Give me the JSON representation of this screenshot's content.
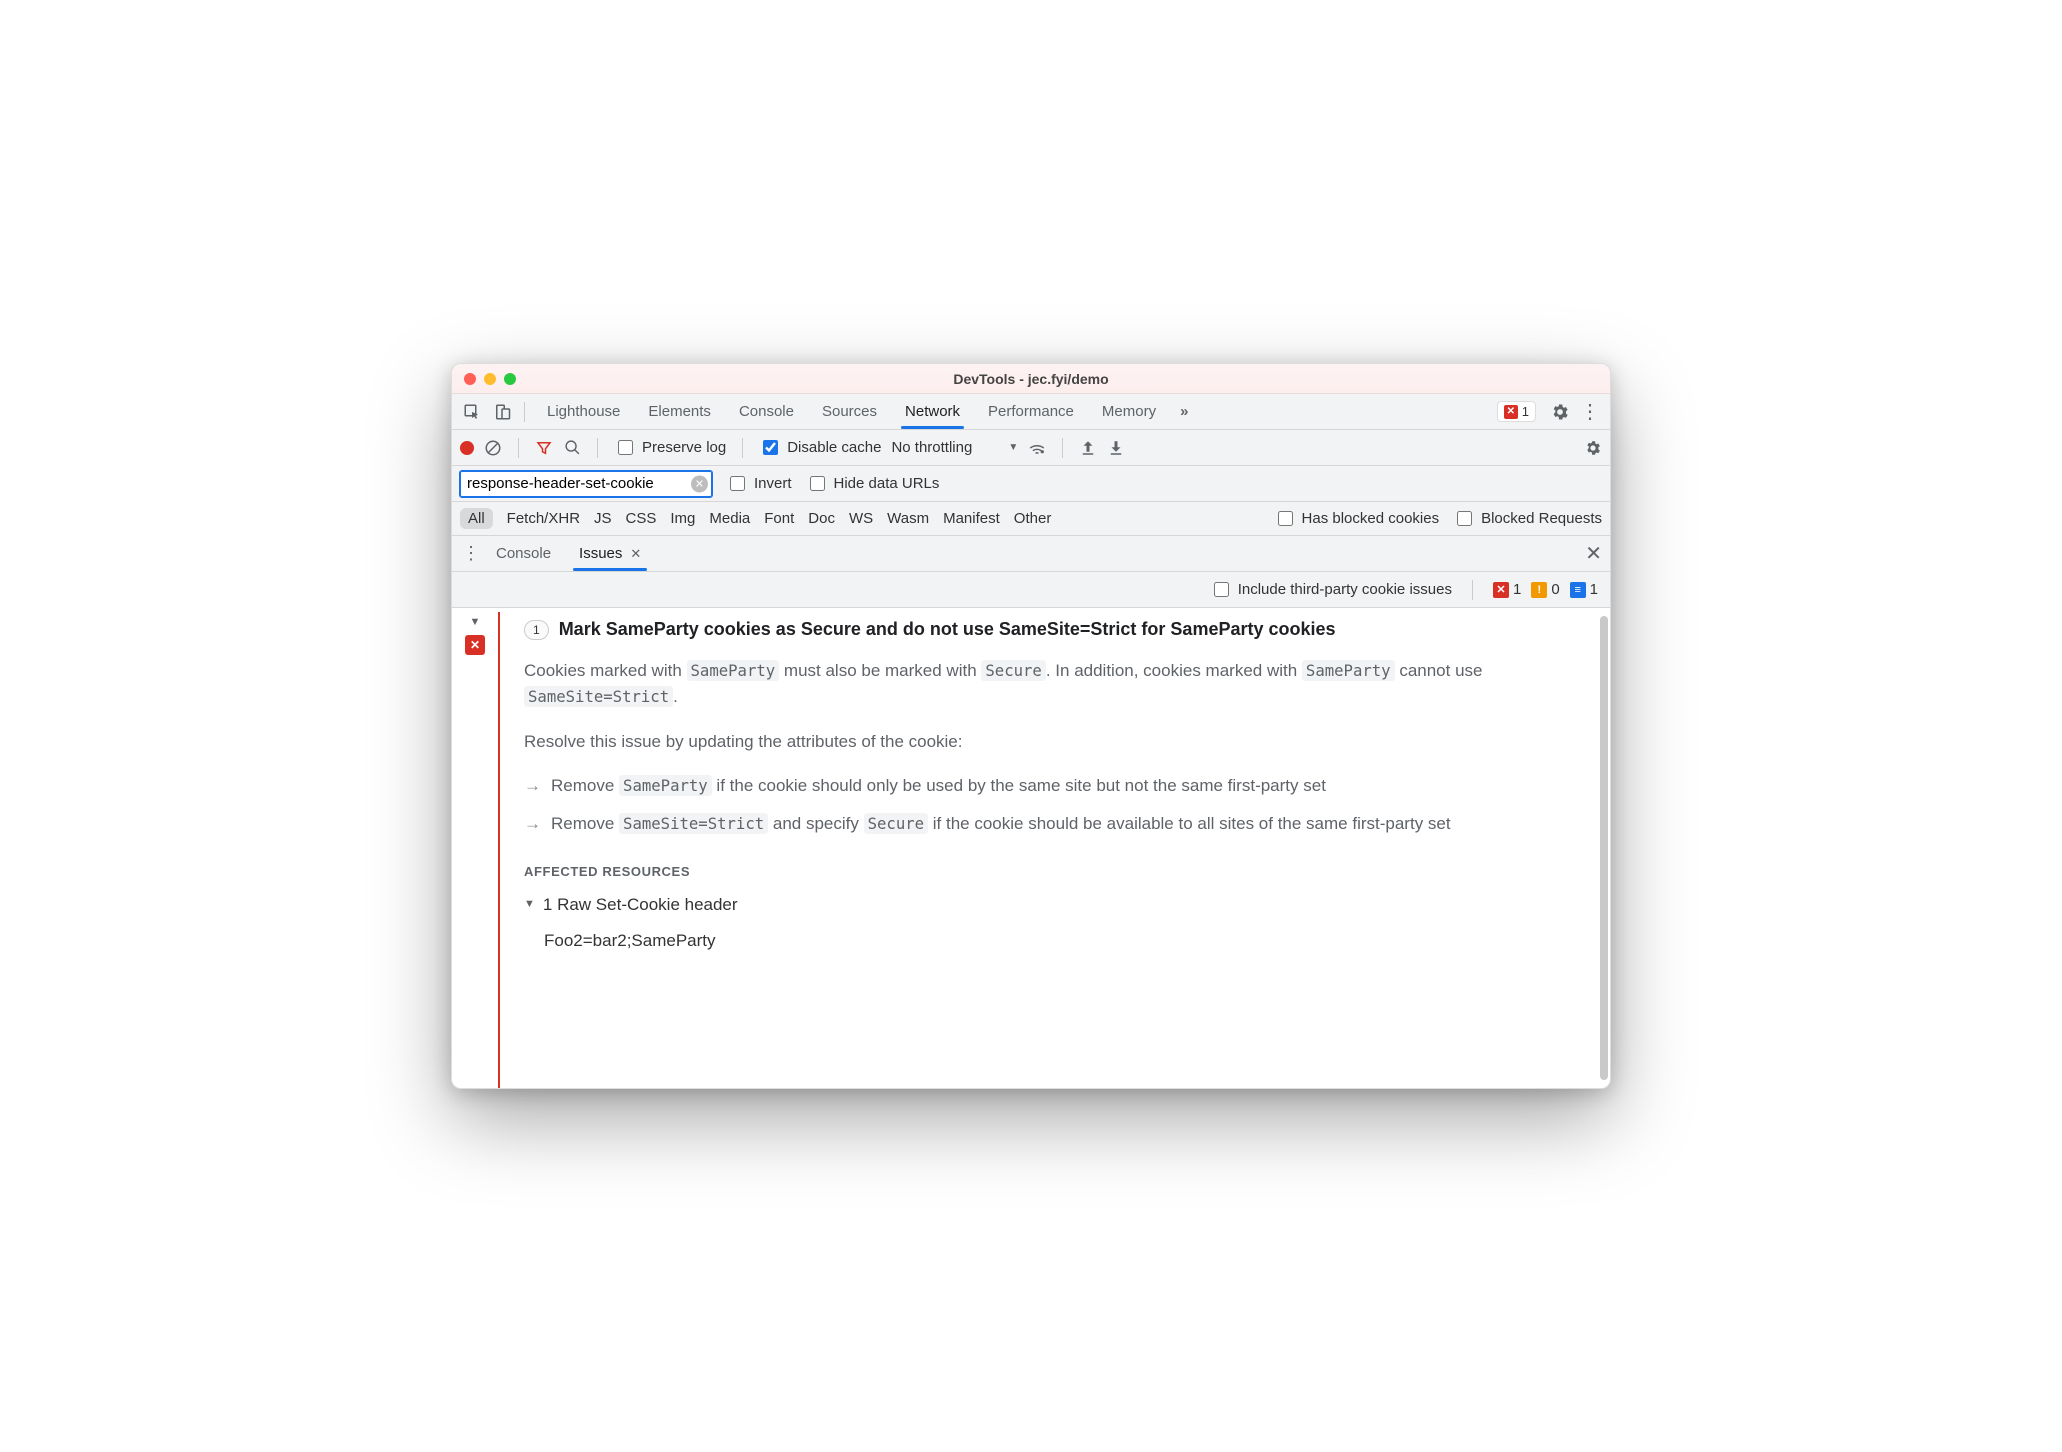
{
  "window": {
    "title": "DevTools - jec.fyi/demo"
  },
  "mainTabs": {
    "items": [
      "Lighthouse",
      "Elements",
      "Console",
      "Sources",
      "Network",
      "Performance",
      "Memory"
    ],
    "activeIndex": 4,
    "overflowGlyph": "»",
    "errorCount": "1"
  },
  "networkToolbar": {
    "preserveLog": {
      "label": "Preserve log",
      "checked": false
    },
    "disableCache": {
      "label": "Disable cache",
      "checked": true
    },
    "throttling": "No throttling"
  },
  "filterRow": {
    "filterValue": "response-header-set-cookie",
    "invert": {
      "label": "Invert",
      "checked": false
    },
    "hideDataUrls": {
      "label": "Hide data URLs",
      "checked": false
    }
  },
  "typeFilters": {
    "items": [
      "All",
      "Fetch/XHR",
      "JS",
      "CSS",
      "Img",
      "Media",
      "Font",
      "Doc",
      "WS",
      "Wasm",
      "Manifest",
      "Other"
    ],
    "activeIndex": 0,
    "hasBlockedCookies": {
      "label": "Has blocked cookies",
      "checked": false
    },
    "blockedRequests": {
      "label": "Blocked Requests",
      "checked": false
    }
  },
  "drawer": {
    "tabs": [
      "Console",
      "Issues"
    ],
    "activeIndex": 1
  },
  "issuesHeader": {
    "includeThirdParty": {
      "label": "Include third-party cookie issues",
      "checked": false
    },
    "counts": {
      "error": "1",
      "warning": "0",
      "info": "1"
    }
  },
  "issue": {
    "count": "1",
    "title": "Mark SameParty cookies as Secure and do not use SameSite=Strict for SameParty cookies",
    "desc": {
      "p1a": "Cookies marked with ",
      "p1b": " must also be marked with ",
      "p1c": ". In addition, cookies marked with ",
      "p1d": " cannot use ",
      "code1": "SameParty",
      "code2": "Secure",
      "code3": "SameParty",
      "code4": "SameSite=Strict",
      "resolve": "Resolve this issue by updating the attributes of the cookie:"
    },
    "bullets": {
      "b1a": "Remove ",
      "b1code": "SameParty",
      "b1b": " if the cookie should only be used by the same site but not the same first-party set",
      "b2a": "Remove ",
      "b2code1": "SameSite=Strict",
      "b2b": " and specify ",
      "b2code2": "Secure",
      "b2c": " if the cookie should be available to all sites of the same first-party set"
    },
    "affected": {
      "heading": "AFFECTED RESOURCES",
      "resourceLabel": "1 Raw Set-Cookie header",
      "cookie": "Foo2=bar2;SameParty"
    }
  }
}
